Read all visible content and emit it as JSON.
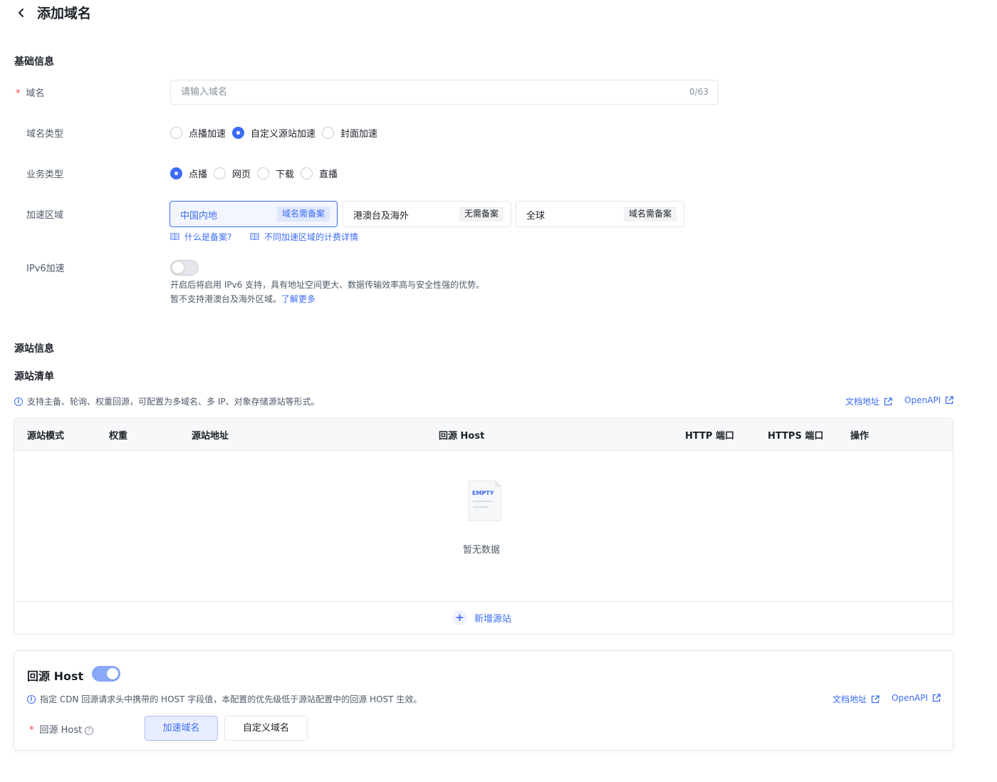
{
  "header": {
    "title": "添加域名"
  },
  "basic": {
    "section_title": "基础信息",
    "domain": {
      "label": "域名",
      "placeholder": "请输入域名",
      "counter": "0/63"
    },
    "domain_type": {
      "label": "域名类型",
      "options": [
        "点播加速",
        "自定义源站加速",
        "封面加速"
      ],
      "selected": "自定义源站加速"
    },
    "service_type": {
      "label": "业务类型",
      "options": [
        "点播",
        "网页",
        "下载",
        "直播"
      ],
      "selected": "点播"
    },
    "region": {
      "label": "加速区域",
      "options": [
        {
          "name": "中国内地",
          "tag": "域名需备案"
        },
        {
          "name": "港澳台及海外",
          "tag": "无需备案"
        },
        {
          "name": "全球",
          "tag": "域名需备案"
        }
      ],
      "selected": "中国内地",
      "help_links": [
        "什么是备案?",
        "不同加速区域的计费详情"
      ]
    },
    "ipv6": {
      "label": "IPv6加速",
      "enabled": false,
      "desc_line1": "开启后将启用 IPv6 支持，具有地址空间更大、数据传输效率高与安全性强的优势。",
      "desc_line2": "暂不支持港澳台及海外区域。",
      "learn_more": "了解更多"
    }
  },
  "origin": {
    "section_title": "源站信息",
    "list_title": "源站清单",
    "info": "支持主备、轮询、权重回源，可配置为多域名、多 IP、对象存储源站等形式。",
    "doc_link": "文档地址",
    "openapi_link": "OpenAPI",
    "table": {
      "columns": [
        "源站模式",
        "权重",
        "源站地址",
        "回源 Host",
        "HTTP 端口",
        "HTTPS 端口",
        "操作"
      ],
      "rows": [],
      "empty_text": "暂无数据",
      "empty_illus_label": "EMPTY"
    },
    "add_button": "新增源站"
  },
  "host": {
    "title": "回源 Host",
    "enabled": true,
    "info": "指定 CDN 回源请求头中携带的 HOST 字段值，本配置的优先级低于源站配置中的回源 HOST 生效。",
    "doc_link": "文档地址",
    "openapi_link": "OpenAPI",
    "field_label": "回源 Host",
    "options": [
      "加速域名",
      "自定义域名"
    ],
    "selected": "加速域名"
  },
  "colors": {
    "accent": "#3c6cf5",
    "required": "#f53f3f",
    "border": "#e5e6eb"
  }
}
